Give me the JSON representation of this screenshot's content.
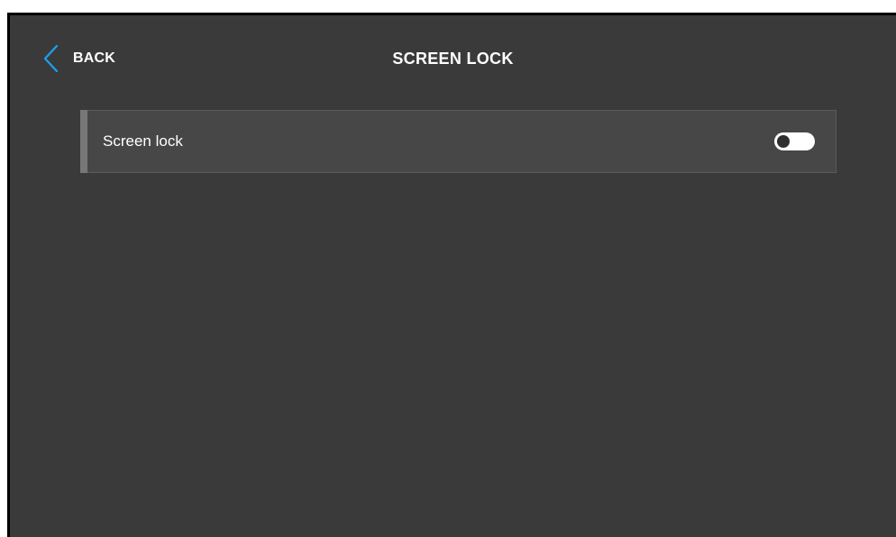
{
  "header": {
    "back_label": "BACK",
    "title": "SCREEN LOCK"
  },
  "settings": {
    "screen_lock": {
      "label": "Screen lock",
      "enabled": false
    }
  },
  "colors": {
    "background": "#3a3a3a",
    "row_background": "#474747",
    "accent_blue": "#1da1f2",
    "text": "#ffffff"
  },
  "icons": {
    "back": "chevron-left-icon"
  }
}
